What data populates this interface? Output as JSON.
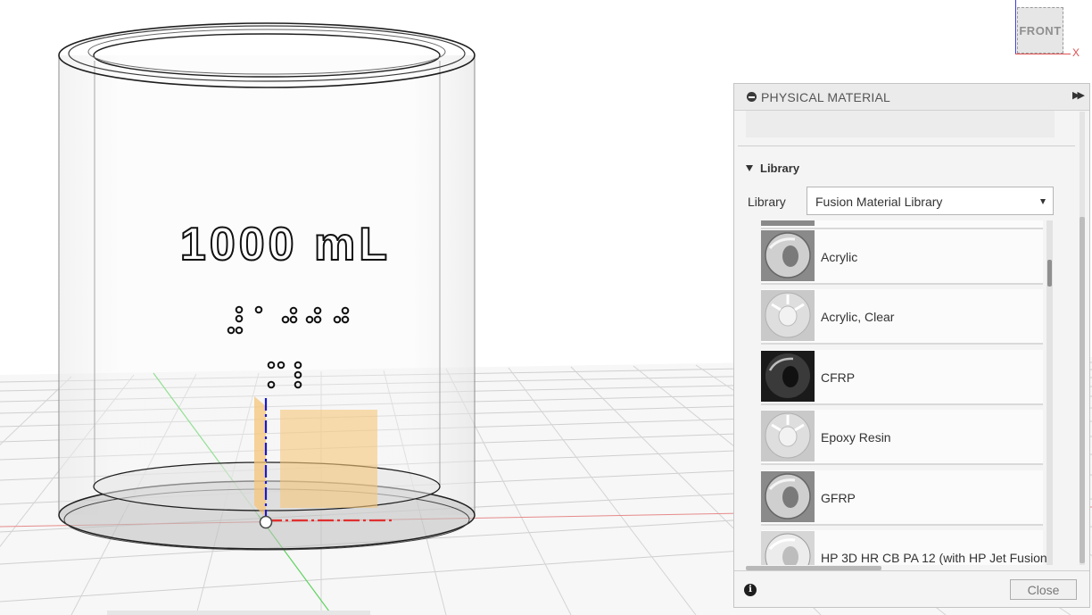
{
  "viewcube": {
    "face_label": "FRONT",
    "x_axis_label": "X"
  },
  "model": {
    "volume_label": "1000 mL"
  },
  "panel": {
    "title": "PHYSICAL MATERIAL",
    "search": {
      "value": "",
      "placeholder": ""
    },
    "section_title": "Library",
    "library_label": "Library",
    "library_selected": "Fusion Material Library",
    "materials": [
      {
        "name": "Acrylic",
        "thumb": "torus-gray"
      },
      {
        "name": "Acrylic, Clear",
        "thumb": "torus-clear"
      },
      {
        "name": "CFRP",
        "thumb": "torus-black"
      },
      {
        "name": "Epoxy Resin",
        "thumb": "torus-clear"
      },
      {
        "name": "GFRP",
        "thumb": "torus-gray"
      },
      {
        "name": "HP 3D HR CB PA 12 (with HP Jet Fusion",
        "thumb": "torus-white"
      }
    ],
    "close_label": "Close"
  },
  "colors": {
    "x_axis": "#e03030",
    "y_axis": "#3fbf3f",
    "z_axis": "#1a1ad0",
    "sketch_plane": "#f6c67a"
  }
}
